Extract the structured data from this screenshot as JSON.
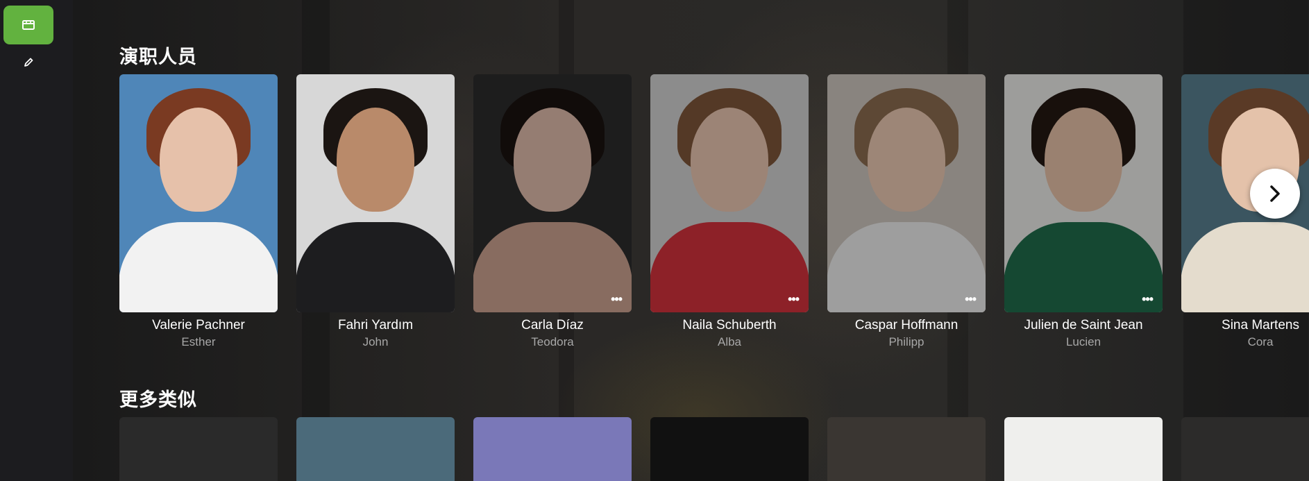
{
  "sidebar": {
    "items": [
      {
        "icon": "film-icon",
        "active": true
      },
      {
        "icon": "pencil-icon",
        "active": false
      }
    ],
    "accent": "#62b23f"
  },
  "cast_section": {
    "title": "演职人员",
    "more_icon": "•••",
    "cast": [
      {
        "name": "Valerie Pachner",
        "role": "Esther",
        "bg": "#4f86b8",
        "hair": "#7a3a22",
        "skin": "#e6c1aa",
        "body": "#f2f2f2"
      },
      {
        "name": "Fahri Yardım",
        "role": "John",
        "bg": "#d7d7d7",
        "hair": "#1b1512",
        "skin": "#b98a6a",
        "body": "#1d1d1f"
      },
      {
        "name": "Carla Díaz",
        "role": "Teodora",
        "bg": "#2c2c2c",
        "hair": "#1a1210",
        "skin": "#dcb8a8",
        "body": "#c99f8e"
      },
      {
        "name": "Naila Schuberth",
        "role": "Alba",
        "bg": "#cfcfcf",
        "hair": "#7c5438",
        "skin": "#e6c3ae",
        "body": "#d0323b"
      },
      {
        "name": "Caspar Hoffmann",
        "role": "Philipp",
        "bg": "#cbc3bc",
        "hair": "#8a6a4e",
        "skin": "#e8c6b0",
        "body": "#e9e9e9"
      },
      {
        "name": "Julien de Saint Jean",
        "role": "Lucien",
        "bg": "#e7e7e5",
        "hair": "#241813",
        "skin": "#e3bfa6",
        "body": "#1f6b4a"
      },
      {
        "name": "Sina Martens",
        "role": "Cora",
        "bg": "#3b5560",
        "hair": "#5a3a26",
        "skin": "#e4c2aa",
        "body": "#e4dccd"
      }
    ]
  },
  "similar_section": {
    "title": "更多类似",
    "posters": [
      {
        "bg": "#2a2a2a"
      },
      {
        "bg": "#4b6a7a"
      },
      {
        "bg": "#7a78b8"
      },
      {
        "bg": "#111111"
      },
      {
        "bg": "#3a3632"
      },
      {
        "bg": "#efefed"
      },
      {
        "bg": "#2c2b2a"
      }
    ]
  }
}
